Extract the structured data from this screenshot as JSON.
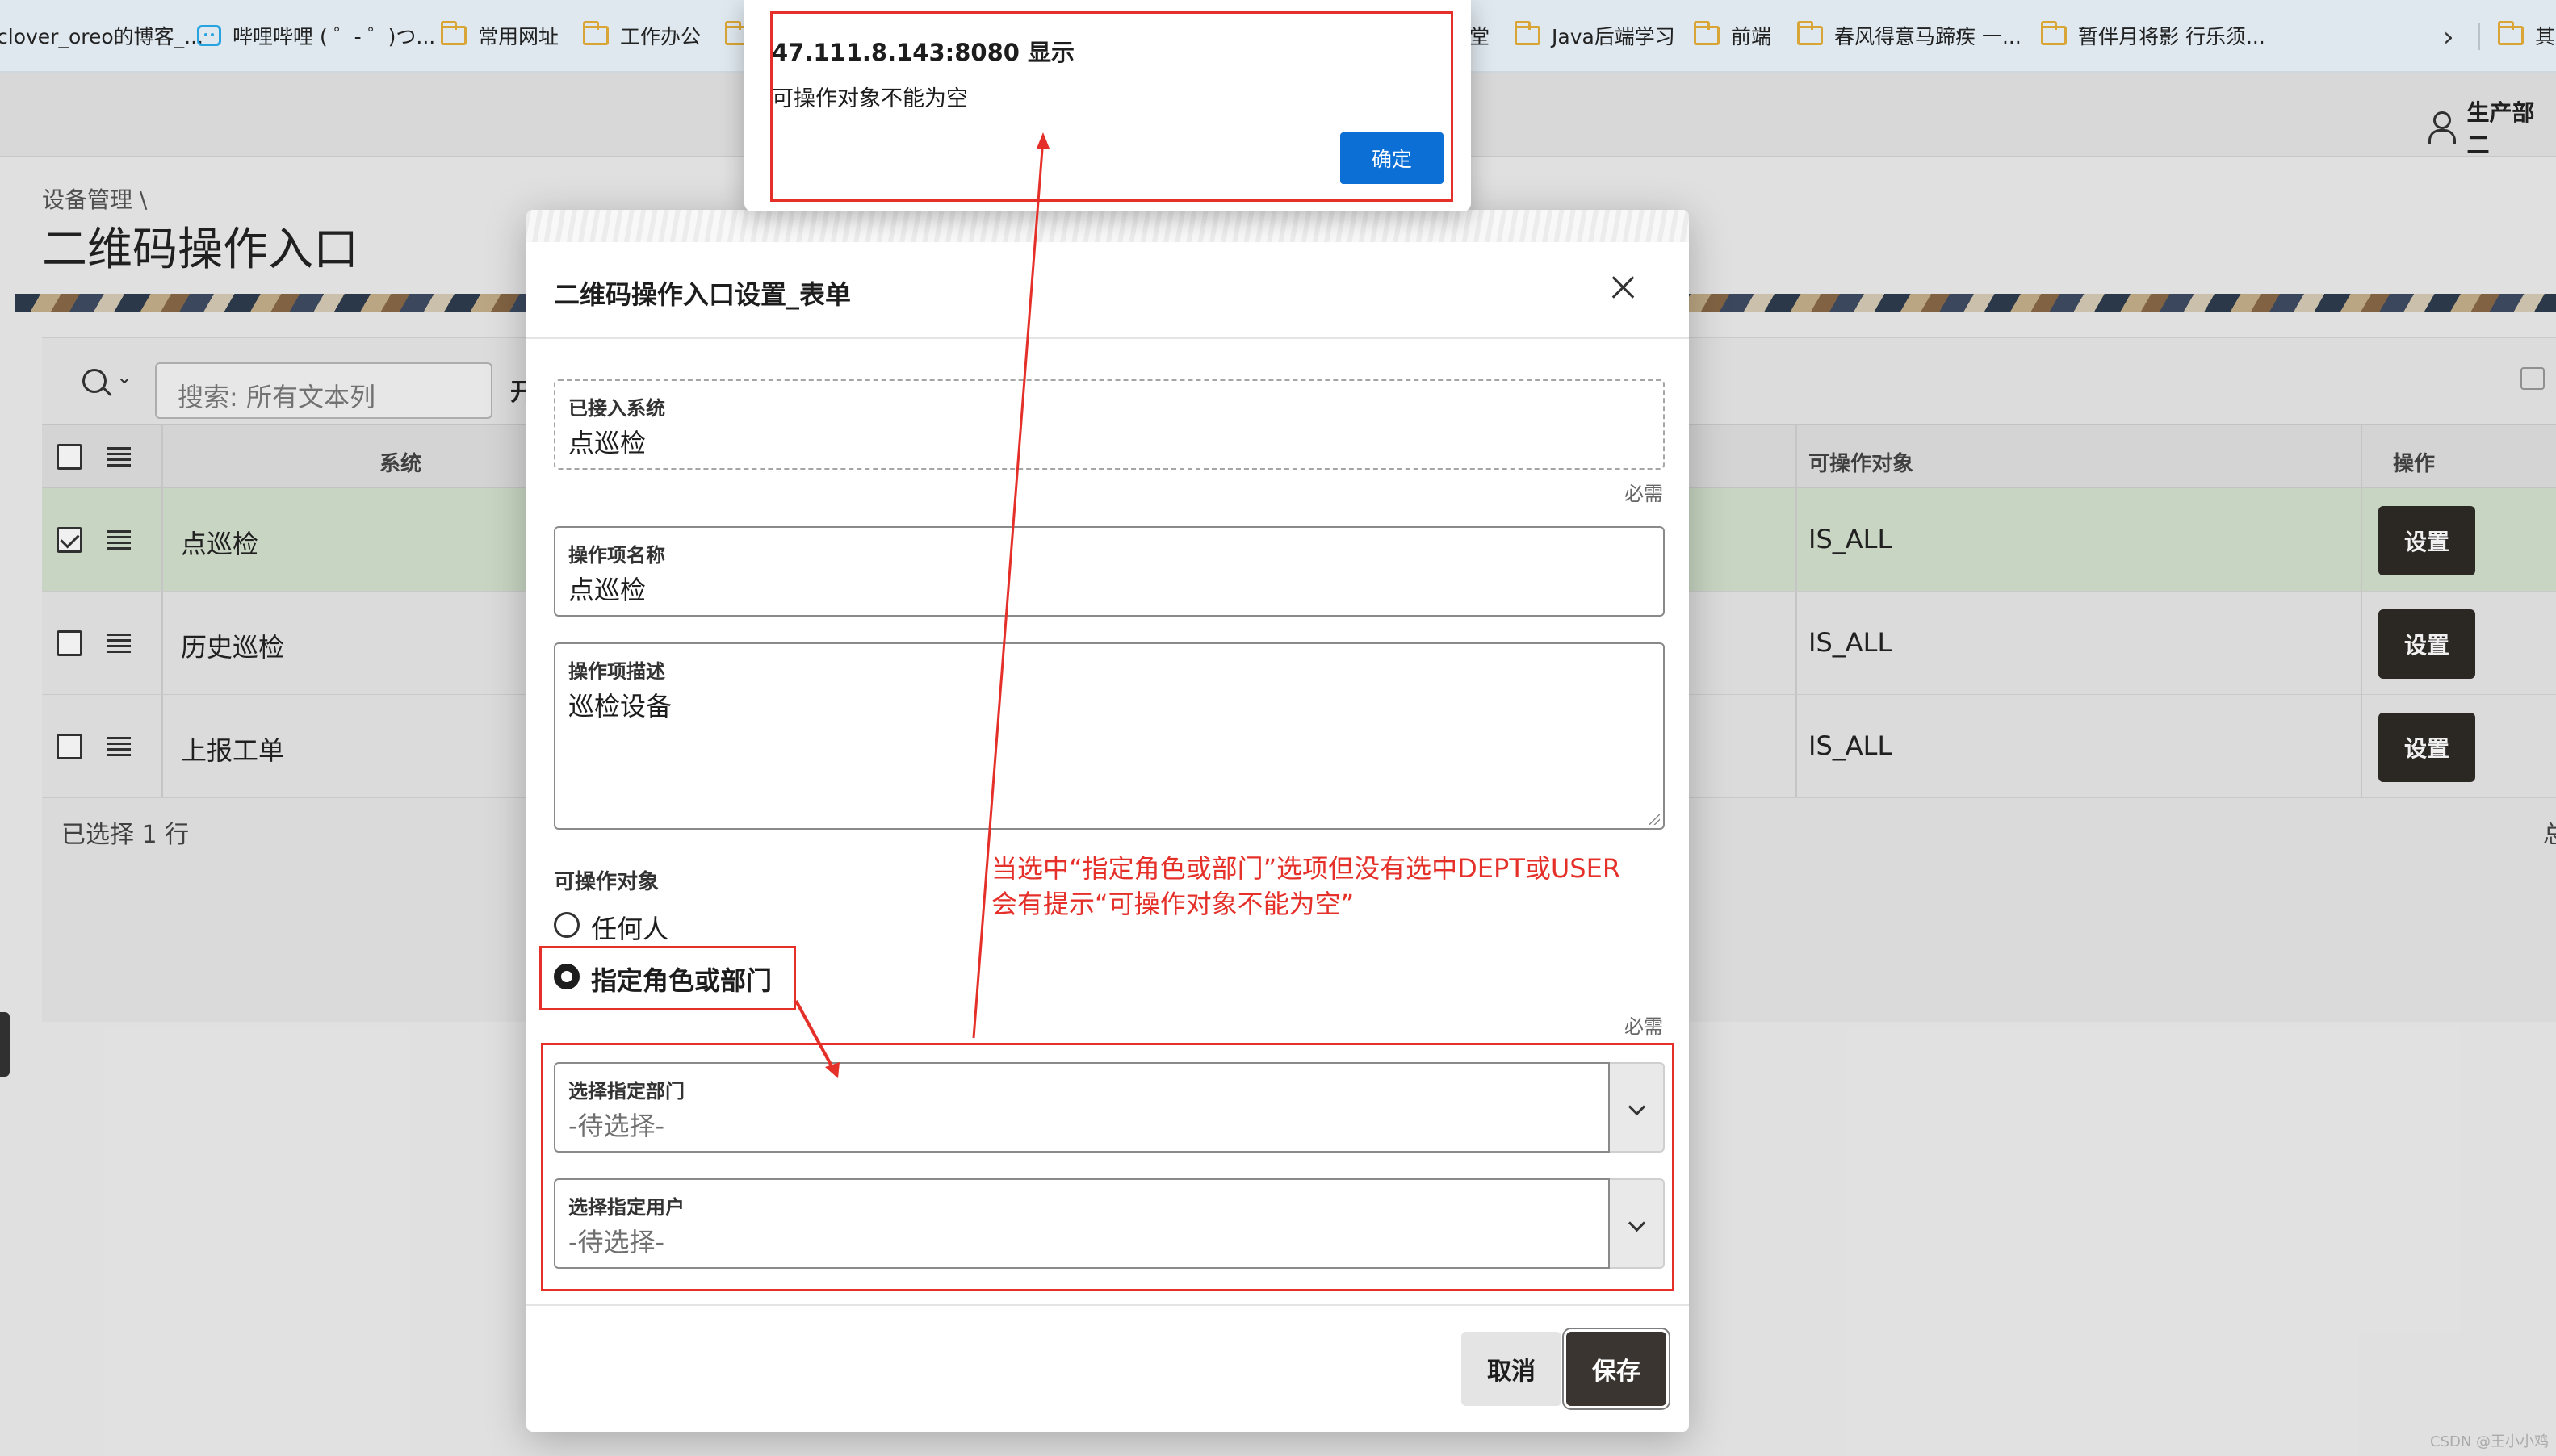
{
  "bookmarks": [
    {
      "label": "clover_oreo的博客_...",
      "icon": "none"
    },
    {
      "label": "哔哩哔哩 ( ゜- ゜)つ...",
      "icon": "bilibili-icon"
    },
    {
      "label": "常用网址",
      "icon": "folder-icon"
    },
    {
      "label": "工作办公",
      "icon": "folder-icon"
    },
    {
      "label": "堂",
      "icon": "none"
    },
    {
      "label": "Java后端学习",
      "icon": "folder-icon"
    },
    {
      "label": "前端",
      "icon": "folder-icon"
    },
    {
      "label": "春风得意马蹄疾 一...",
      "icon": "folder-icon"
    },
    {
      "label": "暂伴月将影 行乐须...",
      "icon": "folder-icon"
    },
    {
      "label": "其",
      "icon": "folder-icon"
    }
  ],
  "header": {
    "user": "生产部二"
  },
  "page": {
    "breadcrumb": "设备管理 \\",
    "title": "二维码操作入口"
  },
  "report": {
    "search_placeholder": "搜索: 所有文本列",
    "toolbar_truncated": "开",
    "columns": {
      "system": "系统",
      "target": "可操作对象",
      "action": "操作"
    },
    "rows": [
      {
        "system": "点巡检",
        "target": "IS_ALL",
        "action": "设置",
        "selected": true
      },
      {
        "system": "历史巡检",
        "target": "IS_ALL",
        "action": "设置",
        "selected": false
      },
      {
        "system": "上报工单",
        "target": "IS_ALL",
        "action": "设置",
        "selected": false
      }
    ],
    "footer": "已选择 1 行",
    "footer_right": "总"
  },
  "modal": {
    "title": "二维码操作入口设置_表单",
    "fields": {
      "system_label": "已接入系统",
      "system_value": "点巡检",
      "required_1": "必需",
      "name_label": "操作项名称",
      "name_value": "点巡检",
      "desc_label": "操作项描述",
      "desc_value": "巡检设备",
      "target_label": "可操作对象",
      "opt_anyone": "任何人",
      "opt_specific": "指定角色或部门",
      "required_2": "必需",
      "dept_label": "选择指定部门",
      "dept_placeholder": "-待选择-",
      "user_label": "选择指定用户",
      "user_placeholder": "-待选择-"
    },
    "cancel": "取消",
    "save": "保存"
  },
  "alert": {
    "title": "47.111.8.143:8080 显示",
    "message": "可操作对象不能为空",
    "ok": "确定"
  },
  "annotation": {
    "line1": "当选中“指定角色或部门”选项但没有选中DEPT或USER",
    "line2": "会有提示“可操作对象不能为空”",
    "color": "#e5302a"
  },
  "watermark": "CSDN @王小小鸡"
}
